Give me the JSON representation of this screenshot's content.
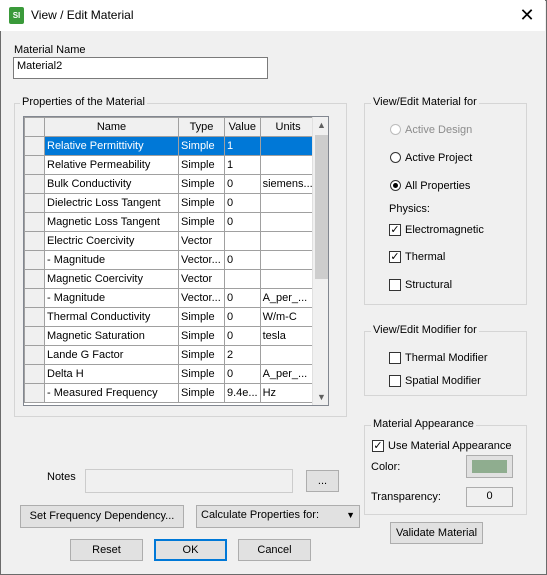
{
  "window": {
    "title": "View / Edit Material",
    "close_glyph": "✕",
    "app_icon": "SI"
  },
  "material_name": {
    "label": "Material Name",
    "value": "Material2"
  },
  "properties": {
    "group_label": "Properties of the Material",
    "columns": [
      "Name",
      "Type",
      "Value",
      "Units"
    ],
    "rows": [
      {
        "name": "Relative Permittivity",
        "type": "Simple",
        "value": "1",
        "units": ""
      },
      {
        "name": "Relative Permeability",
        "type": "Simple",
        "value": "1",
        "units": ""
      },
      {
        "name": "Bulk Conductivity",
        "type": "Simple",
        "value": "0",
        "units": "siemens..."
      },
      {
        "name": "Dielectric Loss Tangent",
        "type": "Simple",
        "value": "0",
        "units": ""
      },
      {
        "name": "Magnetic Loss Tangent",
        "type": "Simple",
        "value": "0",
        "units": ""
      },
      {
        "name": "Electric Coercivity",
        "type": "Vector",
        "value": "",
        "units": ""
      },
      {
        "name": "- Magnitude",
        "type": "Vector...",
        "value": "0",
        "units": ""
      },
      {
        "name": "Magnetic Coercivity",
        "type": "Vector",
        "value": "",
        "units": ""
      },
      {
        "name": "- Magnitude",
        "type": "Vector...",
        "value": "0",
        "units": "A_per_..."
      },
      {
        "name": "Thermal Conductivity",
        "type": "Simple",
        "value": "0",
        "units": "W/m-C"
      },
      {
        "name": "Magnetic Saturation",
        "type": "Simple",
        "value": "0",
        "units": "tesla"
      },
      {
        "name": "Lande G Factor",
        "type": "Simple",
        "value": "2",
        "units": ""
      },
      {
        "name": "Delta H",
        "type": "Simple",
        "value": "0",
        "units": "A_per_..."
      },
      {
        "name": "- Measured Frequency",
        "type": "Simple",
        "value": "9.4e...",
        "units": "Hz"
      }
    ],
    "selected_row": 0
  },
  "view_edit_for": {
    "label": "View/Edit Material for",
    "active_design": "Active Design",
    "active_project": "Active Project",
    "all_properties": "All Properties",
    "selected": "all_properties",
    "physics_label": "Physics:",
    "electromagnetic": {
      "label": "Electromagnetic",
      "checked": true
    },
    "thermal": {
      "label": "Thermal",
      "checked": true
    },
    "structural": {
      "label": "Structural",
      "checked": false
    }
  },
  "modifier": {
    "label": "View/Edit Modifier for",
    "thermal": {
      "label": "Thermal Modifier",
      "checked": false
    },
    "spatial": {
      "label": "Spatial Modifier",
      "checked": false
    }
  },
  "appearance": {
    "label": "Material Appearance",
    "use": {
      "label": "Use Material Appearance",
      "checked": true
    },
    "color_label": "Color:",
    "color": "#8fad8f",
    "transparency_label": "Transparency:",
    "transparency": "0"
  },
  "validate_label": "Validate Material",
  "notes": {
    "label": "Notes",
    "value": "",
    "browse": "..."
  },
  "freq_button": "Set Frequency Dependency...",
  "calc_select": "Calculate Properties for:",
  "buttons": {
    "reset": "Reset",
    "ok": "OK",
    "cancel": "Cancel"
  }
}
